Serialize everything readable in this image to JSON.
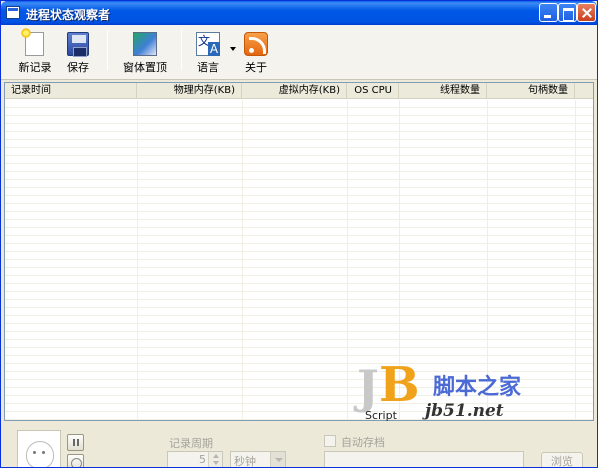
{
  "window": {
    "title": "进程状态观察者"
  },
  "toolbar": {
    "new_record": "新记录",
    "save": "保存",
    "window_top": "窗体置顶",
    "language": "语言",
    "about": "关于"
  },
  "list": {
    "columns": [
      "记录时间",
      "物理内存(KB)",
      "虚拟内存(KB)",
      "OS CPU",
      "线程数量",
      "句柄数量"
    ],
    "rows": []
  },
  "bottom": {
    "record_period_label": "记录周期",
    "period_value": "5",
    "period_unit": "秒钟",
    "auto_archive_label": "自动存档",
    "archive_path": "",
    "browse_button": "浏览"
  },
  "watermark": {
    "logo_j": "J",
    "logo_b": "B",
    "logo_script": "Script",
    "cn": "脚本之家",
    "url": "jb51.net"
  },
  "icons": {
    "new_record": "new-document-icon",
    "save": "floppy-disk-icon",
    "window_top": "window-pin-icon",
    "language": "language-translate-icon",
    "about": "rss-info-icon"
  },
  "colors": {
    "title_bar": "#0054e3",
    "window_border": "#0831d9",
    "watermark_blue": "#4b6ad6",
    "logo_orange": "#f0a21a"
  }
}
